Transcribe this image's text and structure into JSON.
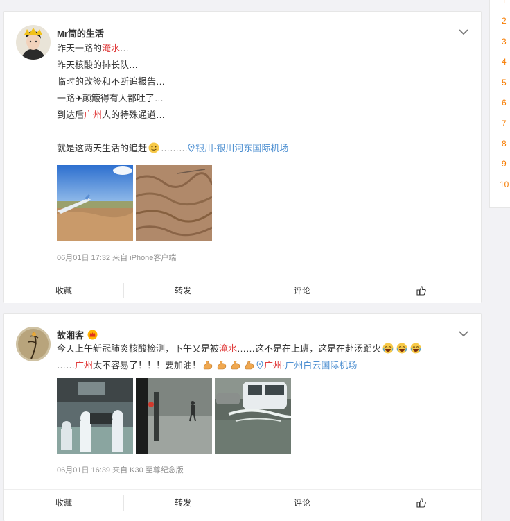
{
  "posts": [
    {
      "username": "Mr筒的生活",
      "lines": [
        [
          {
            "t": "昨天一路的"
          },
          {
            "t": "淹水",
            "kw": true
          },
          {
            "t": "…"
          }
        ],
        [
          {
            "t": "昨天核酸的排长队…"
          }
        ],
        [
          {
            "t": "临时的改签和不断追报告…"
          }
        ],
        [
          {
            "t": "一路✈颠簸得有人都吐了…"
          }
        ],
        [
          {
            "t": "到达后"
          },
          {
            "t": "广州",
            "kw": true
          },
          {
            "t": "人的特殊通道…"
          }
        ],
        [
          {
            "t": ""
          }
        ],
        [
          {
            "t": "就是这两天生活的追赶"
          },
          {
            "emoji": "smile"
          },
          {
            "t": "………"
          },
          {
            "loc": "银川·银川河东国际机场"
          }
        ]
      ],
      "meta": "06月01日 17:32  来自 iPhone客户端",
      "actions": {
        "favorite": "收藏",
        "repost": "转发",
        "comment": "评论"
      }
    },
    {
      "username": "故湘客",
      "lines": [
        [
          {
            "t": "今天上午新冠肺炎核酸检测，下午又是被"
          },
          {
            "t": "淹水",
            "kw": true
          },
          {
            "t": "……这不是在上班，这是在赴汤蹈火"
          },
          {
            "emoji": "lol"
          },
          {
            "emoji": "lol"
          },
          {
            "emoji": "lol"
          }
        ],
        [
          {
            "t": "……"
          },
          {
            "t": "广州",
            "kw": true
          },
          {
            "t": "太不容易了！！！要加油！"
          },
          {
            "emoji": "muscle"
          },
          {
            "emoji": "muscle"
          },
          {
            "emoji": "muscle"
          },
          {
            "emoji": "muscle"
          },
          {
            "loc": "广州·广州白云国际机场",
            "kwpart": "广州"
          }
        ]
      ],
      "meta": "06月01日 16:39  来自 K30 至尊纪念版",
      "actions": {
        "favorite": "收藏",
        "repost": "转发",
        "comment": "评论"
      }
    }
  ],
  "sidebar": {
    "ranks": [
      "1",
      "2",
      "3",
      "4",
      "5",
      "6",
      "7",
      "8",
      "9",
      "10"
    ]
  },
  "colors": {
    "keyword": "#e03b3b",
    "location": "#4d8fd1",
    "rank": "#f77c00"
  }
}
